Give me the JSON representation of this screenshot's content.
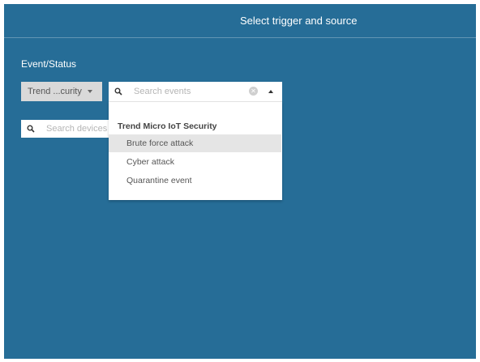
{
  "header": {
    "title": "Select trigger and source"
  },
  "event_status": {
    "label": "Event/Status",
    "source_select": {
      "value": "Trend ...curity"
    },
    "events_search": {
      "placeholder": "Search events",
      "value": ""
    },
    "devices_search": {
      "placeholder": "Search devices",
      "value": ""
    }
  },
  "dropdown": {
    "group_label": "Trend Micro IoT Security",
    "options": [
      {
        "label": "Brute force attack",
        "highlighted": true
      },
      {
        "label": "Cyber attack",
        "highlighted": false
      },
      {
        "label": "Quarantine event",
        "highlighted": false
      }
    ]
  },
  "icons": {
    "search": "search-icon",
    "clear": "clear-icon",
    "source_caret": "caret-down-icon",
    "dropdown_caret": "caret-up-icon"
  },
  "colors": {
    "background": "#266d97",
    "highlight": "#e5e5e5",
    "select_bg": "#d9d9d9"
  }
}
